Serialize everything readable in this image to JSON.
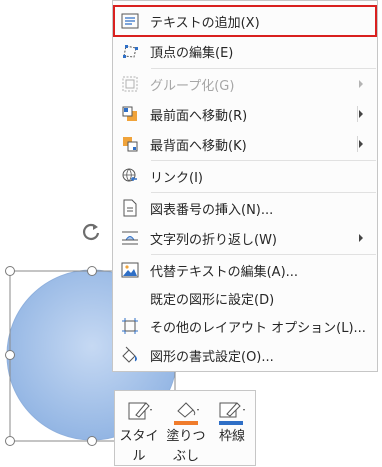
{
  "menu": {
    "items": [
      {
        "label": "テキストの追加(X)",
        "icon": "add-text-icon",
        "disabled": false,
        "submenu": false,
        "highlighted": true
      },
      {
        "label": "頂点の編集(E)",
        "icon": "edit-points-icon",
        "disabled": false,
        "submenu": false,
        "highlighted": false
      },
      {
        "label": "グループ化(G)",
        "icon": "group-icon",
        "disabled": true,
        "submenu": true,
        "highlighted": false
      },
      {
        "label": "最前面へ移動(R)",
        "icon": "bring-to-front-icon",
        "disabled": false,
        "submenu": true,
        "highlighted": false
      },
      {
        "label": "最背面へ移動(K)",
        "icon": "send-to-back-icon",
        "disabled": false,
        "submenu": true,
        "highlighted": false
      },
      {
        "label": "リンク(I)",
        "icon": "link-icon",
        "disabled": false,
        "submenu": false,
        "highlighted": false
      },
      {
        "label": "図表番号の挿入(N)...",
        "icon": "insert-caption-icon",
        "disabled": false,
        "submenu": false,
        "highlighted": false
      },
      {
        "label": "文字列の折り返し(W)",
        "icon": "wrap-text-icon",
        "disabled": false,
        "submenu": true,
        "highlighted": false
      },
      {
        "label": "代替テキストの編集(A)...",
        "icon": "alt-text-icon",
        "disabled": false,
        "submenu": false,
        "highlighted": false
      },
      {
        "label": "既定の図形に設定(D)",
        "icon": "",
        "disabled": false,
        "submenu": false,
        "highlighted": false
      },
      {
        "label": "その他のレイアウト オプション(L)...",
        "icon": "layout-options-icon",
        "disabled": false,
        "submenu": false,
        "highlighted": false
      },
      {
        "label": "図形の書式設定(O)...",
        "icon": "format-shape-icon",
        "disabled": false,
        "submenu": false,
        "highlighted": false
      }
    ]
  },
  "toolbar": {
    "style_label": "スタイル",
    "fill_label": "塗りつぶし",
    "outline_label": "枠線"
  },
  "colors": {
    "highlight_border": "#d9201f",
    "shape_fill": "#a9c5eb",
    "fill_accent": "#f07c2c",
    "outline_accent": "#2f6fc6"
  }
}
